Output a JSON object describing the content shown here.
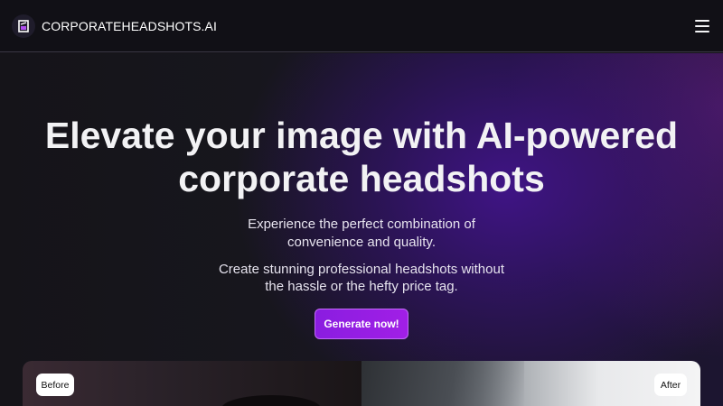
{
  "header": {
    "brand": "CORPORATEHEADSHOTS.AI",
    "logo_icon": "brand-logo-icon",
    "menu_icon": "hamburger-menu-icon"
  },
  "hero": {
    "headline_line1": "Elevate your image with AI-powered",
    "headline_line2": "corporate headshots",
    "subtitle1_line1": "Experience the perfect combination of",
    "subtitle1_line2": "convenience and quality.",
    "subtitle2_line1": "Create stunning professional headshots without",
    "subtitle2_line2": "the hassle or the hefty price tag.",
    "cta_label": "Generate now!"
  },
  "comparison": {
    "before_label": "Before",
    "after_label": "After"
  },
  "colors": {
    "background": "#141318",
    "accent": "#9a1fe4",
    "glow": "#461496"
  }
}
